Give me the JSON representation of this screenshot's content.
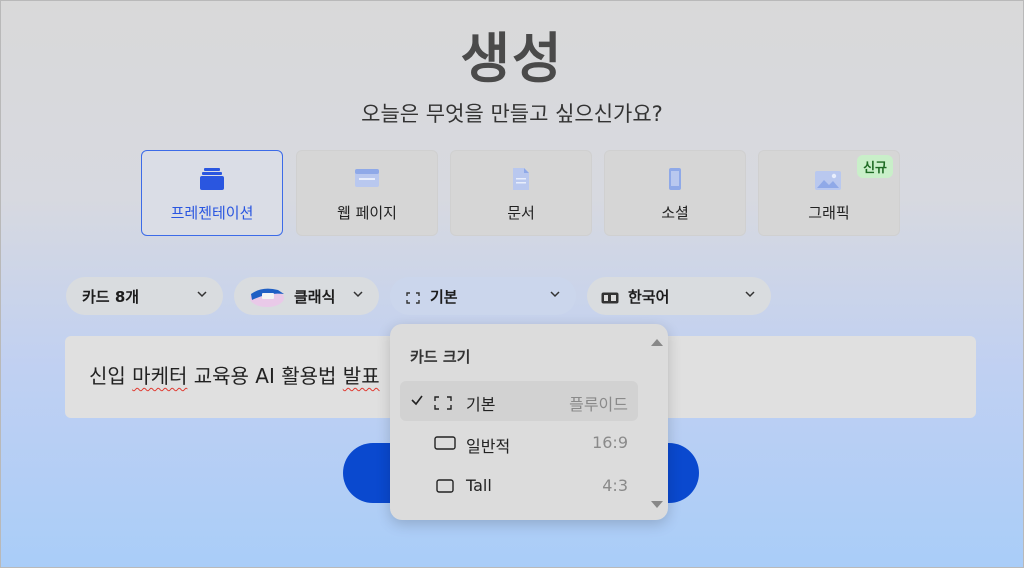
{
  "header": {
    "title": "생성",
    "subtitle": "오늘은 무엇을 만들고 싶으신가요?"
  },
  "types": [
    {
      "label": "프레젠테이션",
      "icon": "presentation-icon",
      "selected": true
    },
    {
      "label": "웹 페이지",
      "icon": "webpage-icon"
    },
    {
      "label": "문서",
      "icon": "document-icon"
    },
    {
      "label": "소셜",
      "icon": "social-phone-icon"
    },
    {
      "label": "그래픽",
      "icon": "graphic-image-icon",
      "badge": "신규"
    }
  ],
  "options": {
    "card_count": "카드 8개",
    "theme": "클래식",
    "card_size": "기본",
    "language": "한국어"
  },
  "prompt": {
    "text_parts": [
      "신입 ",
      "마케터",
      " 교육용 AI 활용법 ",
      "발표"
    ]
  },
  "dropdown": {
    "header": "카드 크기",
    "items": [
      {
        "label": "기본",
        "ratio": "플루이드",
        "selected": true
      },
      {
        "label": "일반적",
        "ratio": "16:9"
      },
      {
        "label": "Tall",
        "ratio": "4:3"
      }
    ]
  },
  "colors": {
    "accent": "#3c6be8",
    "generate_button": "#0a49cf",
    "badge_bg": "#c9efc9",
    "badge_text": "#1f6b24"
  }
}
